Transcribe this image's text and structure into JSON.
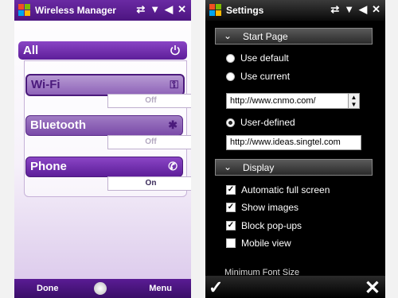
{
  "left": {
    "status_title": "Wireless Manager",
    "all_label": "All",
    "items": [
      {
        "label": "Wi-Fi",
        "state": "Off"
      },
      {
        "label": "Bluetooth",
        "state": "Off"
      },
      {
        "label": "Phone",
        "state": "On"
      }
    ],
    "softkeys": {
      "left": "Done",
      "right": "Menu"
    }
  },
  "right": {
    "status_title": "Settings",
    "start_page_header": "Start Page",
    "options": {
      "use_default": "Use default",
      "use_current": "Use current",
      "user_defined": "User-defined"
    },
    "dropdown_value": "http://www.cnmo.com/",
    "user_defined_value": "http://www.ideas.singtel.com",
    "display_header": "Display",
    "checks": [
      {
        "label": "Automatic full screen",
        "checked": true
      },
      {
        "label": "Show images",
        "checked": true
      },
      {
        "label": "Block pop-ups",
        "checked": true
      },
      {
        "label": "Mobile view",
        "checked": false
      }
    ],
    "faded_label": "Minimum Font Size"
  },
  "colors": {
    "accent": "#5d1e99",
    "accent_light": "#8a45c5"
  }
}
